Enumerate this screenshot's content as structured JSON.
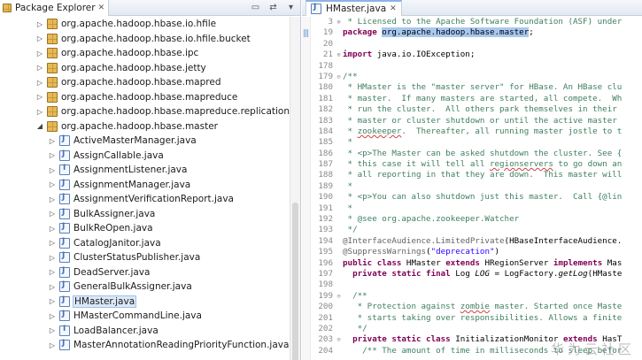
{
  "explorer": {
    "title": "Package Explorer",
    "close": "✕",
    "toolbar": [
      "▭",
      "⇄",
      "▾"
    ],
    "rows": [
      {
        "type": "pkg",
        "arrow": "▷",
        "label": "org.apache.hadoop.hbase.io.hfile"
      },
      {
        "type": "pkg",
        "arrow": "▷",
        "label": "org.apache.hadoop.hbase.io.hfile.bucket"
      },
      {
        "type": "pkg",
        "arrow": "▷",
        "label": "org.apache.hadoop.hbase.ipc"
      },
      {
        "type": "pkg",
        "arrow": "▷",
        "label": "org.apache.hadoop.hbase.jetty"
      },
      {
        "type": "pkg",
        "arrow": "▷",
        "label": "org.apache.hadoop.hbase.mapred"
      },
      {
        "type": "pkg",
        "arrow": "▷",
        "label": "org.apache.hadoop.hbase.mapreduce"
      },
      {
        "type": "pkg",
        "arrow": "▷",
        "label": "org.apache.hadoop.hbase.mapreduce.replication"
      },
      {
        "type": "pkg",
        "arrow": "◢",
        "label": "org.apache.hadoop.hbase.master"
      },
      {
        "type": "java",
        "arrow": "▷",
        "label": "ActiveMasterManager.java"
      },
      {
        "type": "java",
        "arrow": "▷",
        "label": "AssignCallable.java"
      },
      {
        "type": "iface",
        "arrow": "▷",
        "label": "AssignmentListener.java"
      },
      {
        "type": "java",
        "arrow": "▷",
        "label": "AssignmentManager.java"
      },
      {
        "type": "java",
        "arrow": "▷",
        "label": "AssignmentVerificationReport.java"
      },
      {
        "type": "java",
        "arrow": "▷",
        "label": "BulkAssigner.java"
      },
      {
        "type": "java",
        "arrow": "▷",
        "label": "BulkReOpen.java"
      },
      {
        "type": "java",
        "arrow": "▷",
        "label": "CatalogJanitor.java"
      },
      {
        "type": "java",
        "arrow": "▷",
        "label": "ClusterStatusPublisher.java"
      },
      {
        "type": "java",
        "arrow": "▷",
        "label": "DeadServer.java"
      },
      {
        "type": "java",
        "arrow": "▷",
        "label": "GeneralBulkAssigner.java"
      },
      {
        "type": "java",
        "arrow": "▷",
        "label": "HMaster.java",
        "selected": true
      },
      {
        "type": "java",
        "arrow": "▷",
        "label": "HMasterCommandLine.java"
      },
      {
        "type": "iface",
        "arrow": "▷",
        "label": "LoadBalancer.java"
      },
      {
        "type": "java",
        "arrow": "▷",
        "label": "MasterAnnotationReadingPriorityFunction.java"
      }
    ]
  },
  "editor": {
    "tab_title": "HMaster.java",
    "tab_close": "✕",
    "lines": [
      {
        "n": "3",
        "fold": "⊕",
        "parts": [
          {
            "c": "cm",
            "t": " * Licensed to the Apache Software Foundation (ASF) under"
          }
        ]
      },
      {
        "n": "19",
        "fold": "",
        "parts": [
          {
            "c": "kw",
            "t": "package"
          },
          {
            "c": "",
            "t": " "
          },
          {
            "c": "hl",
            "t": "org.apache.hadoop.hbase.master"
          },
          {
            "c": "",
            "t": ";"
          }
        ]
      },
      {
        "n": "20",
        "fold": "",
        "parts": []
      },
      {
        "n": "21",
        "fold": "⊕",
        "parts": [
          {
            "c": "kw",
            "t": "import"
          },
          {
            "c": "",
            "t": " java.io.IOException;"
          }
        ]
      },
      {
        "n": "178",
        "fold": "",
        "parts": []
      },
      {
        "n": "179",
        "fold": "⊖",
        "parts": [
          {
            "c": "cm",
            "t": "/**"
          }
        ]
      },
      {
        "n": "180",
        "fold": "",
        "parts": [
          {
            "c": "cm",
            "t": " * HMaster is the \"master server\" for HBase. An HBase clu"
          }
        ]
      },
      {
        "n": "181",
        "fold": "",
        "parts": [
          {
            "c": "cm",
            "t": " * master.  If many masters are started, all compete.  Wh"
          }
        ]
      },
      {
        "n": "182",
        "fold": "",
        "parts": [
          {
            "c": "cm",
            "t": " * run the cluster.  All others park themselves in their"
          }
        ]
      },
      {
        "n": "183",
        "fold": "",
        "parts": [
          {
            "c": "cm",
            "t": " * master or cluster shutdown or until the active master"
          }
        ]
      },
      {
        "n": "184",
        "fold": "",
        "parts": [
          {
            "c": "cm",
            "t": " * "
          },
          {
            "c": "cm spell",
            "t": "zookeeper"
          },
          {
            "c": "cm",
            "t": ".  Thereafter, all running master jostle to t"
          }
        ]
      },
      {
        "n": "185",
        "fold": "",
        "parts": [
          {
            "c": "cm",
            "t": " *"
          }
        ]
      },
      {
        "n": "186",
        "fold": "",
        "parts": [
          {
            "c": "cm",
            "t": " * <p>The Master can be asked shutdown the cluster. See {"
          }
        ]
      },
      {
        "n": "187",
        "fold": "",
        "parts": [
          {
            "c": "cm",
            "t": " * this case it will tell all "
          },
          {
            "c": "cm spell",
            "t": "regionservers"
          },
          {
            "c": "cm",
            "t": " to go down an"
          }
        ]
      },
      {
        "n": "188",
        "fold": "",
        "parts": [
          {
            "c": "cm",
            "t": " * all reporting in that they are down.  This master will"
          }
        ]
      },
      {
        "n": "189",
        "fold": "",
        "parts": [
          {
            "c": "cm",
            "t": " *"
          }
        ]
      },
      {
        "n": "190",
        "fold": "",
        "parts": [
          {
            "c": "cm",
            "t": " * <p>You can also shutdown just this master.  Call {@lin"
          }
        ]
      },
      {
        "n": "191",
        "fold": "",
        "parts": [
          {
            "c": "cm",
            "t": " *"
          }
        ]
      },
      {
        "n": "192",
        "fold": "",
        "parts": [
          {
            "c": "cm",
            "t": " * @see org.apache.zookeeper.Watcher"
          }
        ]
      },
      {
        "n": "193",
        "fold": "",
        "parts": [
          {
            "c": "cm",
            "t": " */"
          }
        ]
      },
      {
        "n": "194",
        "fold": "",
        "parts": [
          {
            "c": "an",
            "t": "@InterfaceAudience.LimitedPrivate"
          },
          {
            "c": "",
            "t": "(HBaseInterfaceAudience."
          }
        ]
      },
      {
        "n": "195",
        "fold": "",
        "parts": [
          {
            "c": "an",
            "t": "@SuppressWarnings"
          },
          {
            "c": "",
            "t": "("
          },
          {
            "c": "st",
            "t": "\"deprecation\""
          },
          {
            "c": "",
            "t": ")"
          }
        ]
      },
      {
        "n": "196",
        "fold": "",
        "parts": [
          {
            "c": "kw",
            "t": "public class"
          },
          {
            "c": "",
            "t": " HMaster "
          },
          {
            "c": "kw",
            "t": "extends"
          },
          {
            "c": "",
            "t": " HRegionServer "
          },
          {
            "c": "kw",
            "t": "implements"
          },
          {
            "c": "",
            "t": " Mas"
          }
        ]
      },
      {
        "n": "197",
        "fold": "",
        "parts": [
          {
            "c": "",
            "t": "  "
          },
          {
            "c": "kw",
            "t": "private static final"
          },
          {
            "c": "",
            "t": " Log "
          },
          {
            "c": "it",
            "t": "LOG"
          },
          {
            "c": "",
            "t": " = LogFactory."
          },
          {
            "c": "it",
            "t": "getLog"
          },
          {
            "c": "",
            "t": "(HMaste"
          }
        ]
      },
      {
        "n": "198",
        "fold": "",
        "parts": []
      },
      {
        "n": "199",
        "fold": "⊖",
        "parts": [
          {
            "c": "cm",
            "t": "  /**"
          }
        ]
      },
      {
        "n": "200",
        "fold": "",
        "parts": [
          {
            "c": "cm",
            "t": "   * Protection against "
          },
          {
            "c": "cm spell",
            "t": "zombie"
          },
          {
            "c": "cm",
            "t": " master. Started once Maste"
          }
        ]
      },
      {
        "n": "201",
        "fold": "",
        "parts": [
          {
            "c": "cm",
            "t": "   * starts taking over responsibilities. Allows a finite"
          }
        ]
      },
      {
        "n": "202",
        "fold": "",
        "parts": [
          {
            "c": "cm",
            "t": "   */"
          }
        ]
      },
      {
        "n": "203",
        "fold": "⊖",
        "parts": [
          {
            "c": "",
            "t": "  "
          },
          {
            "c": "kw",
            "t": "private static class"
          },
          {
            "c": "",
            "t": " InitializationMonitor "
          },
          {
            "c": "kw",
            "t": "extends"
          },
          {
            "c": "",
            "t": " HasT"
          }
        ]
      },
      {
        "n": "204",
        "fold": "",
        "parts": [
          {
            "c": "cm",
            "t": "    /** The amount of time in milliseconds to sleep befor"
          }
        ]
      }
    ]
  },
  "watermark": "华为云社区"
}
